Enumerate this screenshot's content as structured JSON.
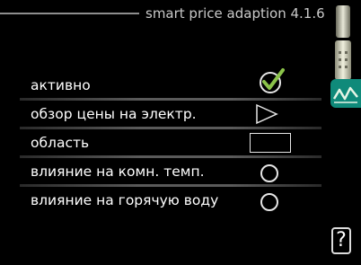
{
  "header": {
    "title": "smart price adaption 4.1.6"
  },
  "menu": {
    "items": [
      {
        "label": "активно",
        "control": "checkbox",
        "checked": true,
        "icon": "checkmark-icon"
      },
      {
        "label": "обзор цены на электр.",
        "control": "submenu-arrow",
        "icon": "triangle-right-icon"
      },
      {
        "label": "область",
        "control": "text-field",
        "value": ""
      },
      {
        "label": "влияние на комн. темп.",
        "control": "radio",
        "selected": false
      },
      {
        "label": "влияние на горячую воду",
        "control": "radio",
        "selected": false
      }
    ]
  },
  "sidebar": {
    "active_tab_icon": "price-graph-icon",
    "help_label": "?",
    "colors": {
      "tab": "#0f8a7a",
      "check": "#8bc34a"
    }
  }
}
